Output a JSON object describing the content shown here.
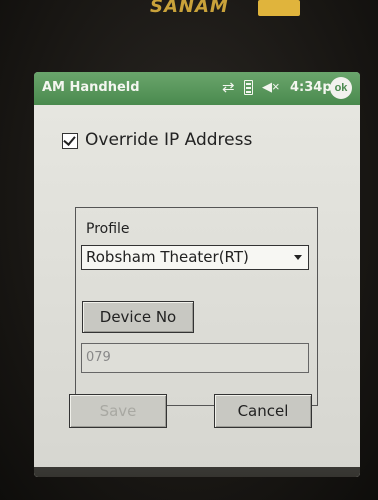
{
  "device": {
    "brand": "SANAM"
  },
  "statusbar": {
    "app_title": "AM Handheld",
    "connectivity_icon": "connectivity-x-icon",
    "battery_icon": "battery-icon",
    "speaker_icon": "speaker-mute-icon",
    "time": "4:34p",
    "ok_label": "ok"
  },
  "form": {
    "override_ip": {
      "label": "Override IP Address",
      "checked": true
    },
    "profile": {
      "label": "Profile",
      "selected": "Robsham Theater(RT)"
    },
    "device_no": {
      "button_label": "Device No",
      "value": "079"
    },
    "save_label": "Save",
    "cancel_label": "Cancel"
  },
  "taskbar": {
    "keyboard_icon": "keyboard-icon"
  },
  "colors": {
    "titlebar": "#4a8a4e",
    "screen_bg": "#dcdcd6"
  }
}
